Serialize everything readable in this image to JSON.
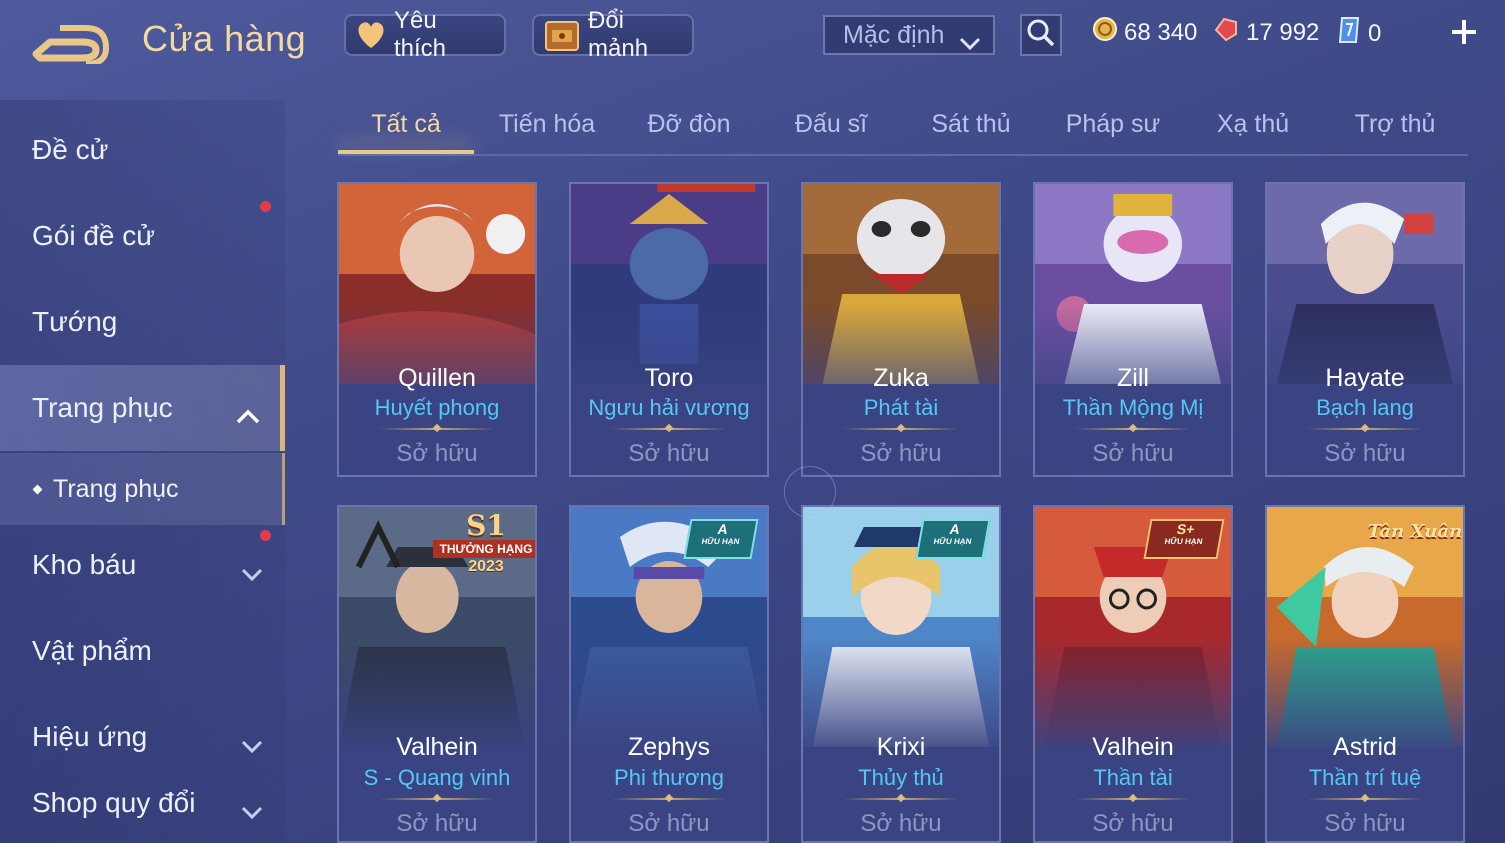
{
  "header": {
    "title": "Cửa hàng",
    "favorites_label": "Yêu thích",
    "exchange_label": "Đổi mảnh",
    "sort_selected": "Mặc định",
    "currency_gold": "68 340",
    "currency_voucher": "17 992",
    "currency_gem": "0"
  },
  "sidebar": {
    "items": [
      {
        "label": "Đề cử"
      },
      {
        "label": "Gói đề cử"
      },
      {
        "label": "Tướng"
      },
      {
        "label": "Trang phục"
      },
      {
        "label": "Kho báu"
      },
      {
        "label": "Vật phẩm"
      },
      {
        "label": "Hiệu ứng"
      },
      {
        "label": "Shop quy đổi"
      }
    ],
    "sub_item": "Trang phục"
  },
  "tabs": [
    "Tất cả",
    "Tiến hóa",
    "Đỡ đòn",
    "Đấu sĩ",
    "Sát thủ",
    "Pháp sư",
    "Xạ thủ",
    "Trợ thủ"
  ],
  "cards": [
    {
      "hero": "Quillen",
      "skin": "Huyết phong",
      "status": "Sở hữu"
    },
    {
      "hero": "Toro",
      "skin": "Ngưu hải vương",
      "status": "Sở hữu"
    },
    {
      "hero": "Zuka",
      "skin": "Phát tài",
      "status": "Sở hữu"
    },
    {
      "hero": "Zill",
      "skin": "Thần Mộng Mị",
      "status": "Sở hữu"
    },
    {
      "hero": "Hayate",
      "skin": "Bạch lang",
      "status": "Sở hữu"
    },
    {
      "hero": "Valhein",
      "skin": "S - Quang vinh",
      "status": "Sở hữu",
      "badge_top": "S1",
      "badge_mid": "THƯỞNG HẠNG",
      "badge_bot": "2023"
    },
    {
      "hero": "Zephys",
      "skin": "Phi thương",
      "status": "Sở hữu",
      "badge_top": "A",
      "badge_mid": "HỮU HẠN"
    },
    {
      "hero": "Krixi",
      "skin": "Thủy thủ",
      "status": "Sở hữu",
      "badge_top": "A",
      "badge_mid": "HỮU HẠN"
    },
    {
      "hero": "Valhein",
      "skin": "Thần tài",
      "status": "Sở hữu",
      "badge_top": "S+",
      "badge_mid": "HỮU HẠN"
    },
    {
      "hero": "Astrid",
      "skin": "Thần trí tuệ",
      "status": "Sở hữu",
      "badge_top": "Tân Xuân"
    }
  ]
}
